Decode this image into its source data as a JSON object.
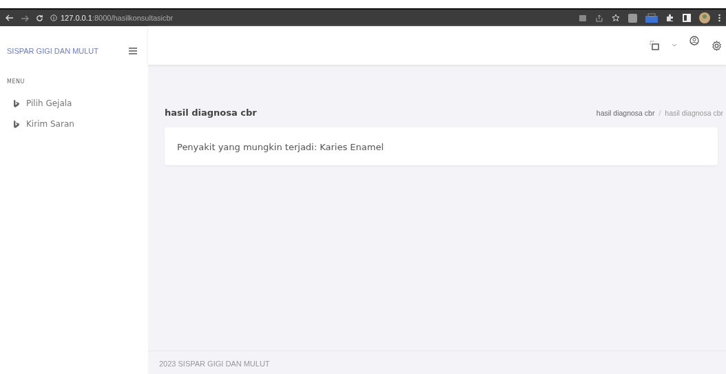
{
  "browser": {
    "url_host": "127.0.0.1",
    "url_path": ":8000/hasilkonsultasicbr"
  },
  "sidebar": {
    "brand": "SISPAR GIGI DAN MULUT",
    "section": "MENU",
    "items": [
      {
        "label": "Pilih Gejala"
      },
      {
        "label": "Kirim Saran"
      }
    ]
  },
  "page": {
    "title": "hasil diagnosa cbr",
    "breadcrumb": [
      "hasil diagnosa cbr",
      "hasil diagnosa cbr"
    ],
    "breadcrumb_separator": "/",
    "result": "Penyakit yang mungkin terjadi: Karies Enamel"
  },
  "footer": "2023 SISPAR GIGI DAN MULUT"
}
